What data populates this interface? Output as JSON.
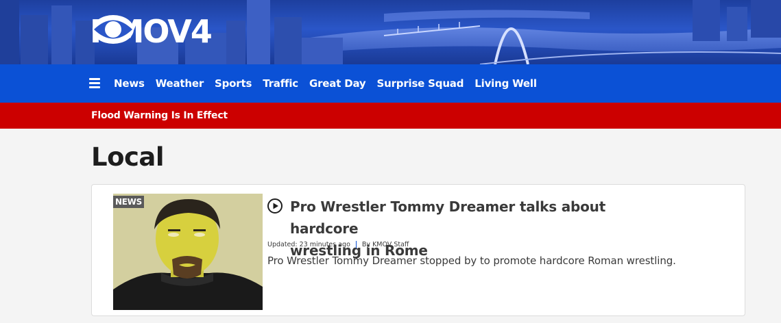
{
  "brand": {
    "name": "KMOV4",
    "colors": {
      "nav": "#0b51d6",
      "alert": "#cc0000",
      "hero": "#1d3f9e"
    }
  },
  "nav": {
    "menu_icon": "hamburger-menu-icon",
    "items": [
      {
        "label": "News"
      },
      {
        "label": "Weather"
      },
      {
        "label": "Sports"
      },
      {
        "label": "Traffic"
      },
      {
        "label": "Great Day"
      },
      {
        "label": "Surprise Squad"
      },
      {
        "label": "Living Well"
      }
    ]
  },
  "alert": {
    "text": "Flood Warning Is In Effect"
  },
  "section": {
    "title": "Local"
  },
  "articles": [
    {
      "tag": "NEWS",
      "headline_line1": "Pro Wrestler Tommy Dreamer talks about hardcore",
      "headline_line2": "wrestling in Rome",
      "updated": "Updated: 23 minutes ago",
      "byline": "By KMOV Staff",
      "description": "Pro Wrestler Tommy Dreamer stopped by to promote hardcore Roman wrestling.",
      "media_icon": "play-circle-icon"
    }
  ]
}
